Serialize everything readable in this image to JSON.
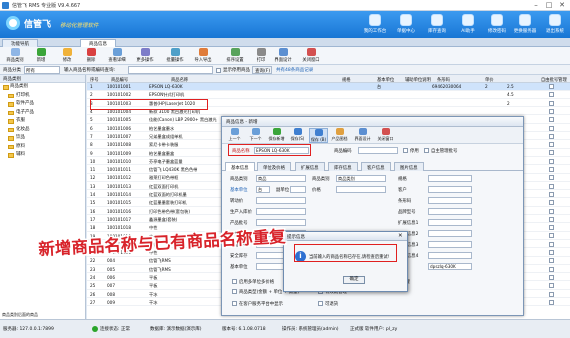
{
  "window": {
    "title": "信管飞 RMS 专业版 V9.4.667"
  },
  "brand": {
    "name": "信管飞",
    "slogan": "移动化管理软件"
  },
  "top_toolbar": [
    {
      "label": "我的工作台",
      "icon": "desktop-icon"
    },
    {
      "label": "单据中心",
      "icon": "document-icon"
    },
    {
      "label": "库存查询",
      "icon": "box-icon"
    },
    {
      "label": "AI助手",
      "icon": "ai-icon"
    },
    {
      "label": "修改密码",
      "icon": "lock-icon"
    },
    {
      "label": "更换服务器",
      "icon": "server-icon"
    },
    {
      "label": "退出系统",
      "icon": "exit-icon"
    }
  ],
  "tabs": [
    {
      "label": "功能导航"
    },
    {
      "label": "商品信息"
    }
  ],
  "toolbar": [
    {
      "label": "商品类别"
    },
    {
      "label": "新增"
    },
    {
      "label": "修改"
    },
    {
      "label": "删除"
    },
    {
      "label": "查看详细"
    },
    {
      "label": "更多操作"
    },
    {
      "label": "批量操作"
    },
    {
      "label": "导入导出"
    },
    {
      "label": "排序设置"
    },
    {
      "label": "打印"
    },
    {
      "label": "界面设计"
    },
    {
      "label": "关闭窗口"
    }
  ],
  "filter": {
    "category_label": "商品分类",
    "category_value": "所有",
    "search_label": "输入商品名称或编码查询:",
    "checkbox_label": "显示停用商品",
    "query_button": "查询(F)",
    "result_text": "共有48条商品记录"
  },
  "left_panel": {
    "header": "商品类别",
    "categories": [
      "打印机",
      "软件产品",
      "电子产品",
      "衣服",
      "化妆品",
      "饮品",
      "原料",
      "辅料"
    ],
    "show_sub": "商品类别后面的商品",
    "footer": "服务器: 127.0.0.1:7899"
  },
  "grid": {
    "columns": [
      "序号",
      "商品编号",
      "商品名称",
      "规格",
      "基本单位",
      "辅助单位说明",
      "条形码",
      "",
      "单价",
      "",
      "",
      "自由批号管理"
    ],
    "rows": [
      {
        "no": "1",
        "code": "100101001",
        "name": "EPSON LQ-630K"
      },
      {
        "no": "2",
        "code": "100101002",
        "name": "EPSON针式打印机"
      },
      {
        "no": "3",
        "code": "100101003",
        "name": "惠普(HP)LaserJet 1020"
      },
      {
        "no": "4",
        "code": "100101004",
        "name": "新款 3100 黑白激光打印机"
      },
      {
        "no": "5",
        "code": "100101005",
        "name": "佳能(Canon) LBP 2900+ 黑白激光"
      },
      {
        "no": "6",
        "code": "100101006",
        "name": "柏艺墨盒墨水"
      },
      {
        "no": "7",
        "code": "100101007",
        "name": "兄弟墨盒成组单机"
      },
      {
        "no": "8",
        "code": "100101008",
        "name": "索尼卡带卡装服"
      },
      {
        "no": "9",
        "code": "100101009",
        "name": "柏艺墨盒墨盒"
      },
      {
        "no": "10",
        "code": "100101010",
        "name": "芬亭电子墨盒蓝量"
      },
      {
        "no": "11",
        "code": "100101011",
        "name": "信管飞 LQ430K 黑色色带"
      },
      {
        "no": "12",
        "code": "100101012",
        "name": "雅莱打印色带框"
      },
      {
        "no": "13",
        "code": "100101013",
        "name": "红蓝双面打印机"
      },
      {
        "no": "14",
        "code": "100101014",
        "name": "红蓝双面的打印机墨"
      },
      {
        "no": "15",
        "code": "100101015",
        "name": "红蓝墨墨套装打印机"
      },
      {
        "no": "16",
        "code": "100101016",
        "name": "打印色带色带(套包装)"
      },
      {
        "no": "17",
        "code": "100101017",
        "name": "鑫源墨盒(套装)"
      },
      {
        "no": "18",
        "code": "100101018",
        "name": "中性"
      },
      {
        "no": "19",
        "code": "100101019",
        "name": "中性"
      },
      {
        "no": "20",
        "code": "100101020",
        "name": "中性"
      },
      {
        "no": "21",
        "code": "100101021",
        "name": "中性"
      },
      {
        "no": "22",
        "code": "004",
        "name": "信管飞RMS"
      },
      {
        "no": "23",
        "code": "005",
        "name": "信管飞RMS"
      },
      {
        "no": "24",
        "code": "006",
        "name": "平板"
      },
      {
        "no": "25",
        "code": "007",
        "name": "平板"
      },
      {
        "no": "26",
        "code": "008",
        "name": "干冰"
      },
      {
        "no": "27",
        "code": "009",
        "name": "干冰"
      }
    ],
    "right_values": [
      {
        "price": "2",
        "v": "2.5"
      },
      {
        "price": "",
        "v": "4.5"
      },
      {
        "price": "",
        "v": "2"
      }
    ],
    "first_barcode": "69462030064",
    "first_unit": "台"
  },
  "dialog": {
    "title": "商品信息 - 新增",
    "toolbar": [
      "上一个",
      "下一个",
      "保存新增",
      "保存(S)",
      "保存 (B)",
      "产品图档",
      "界面设计",
      "关闭窗口"
    ],
    "name_label": "商品名称",
    "name_value": "EPSON LQ-630K",
    "code_label": "商品编码",
    "code_value": "",
    "stop_label": "停用",
    "batch_label": "自主管理批号",
    "tabs": [
      "基本信息",
      "单位及价格",
      "扩展信息",
      "库存信息",
      "客户信息",
      "图片信息"
    ],
    "fields": {
      "category_label": "商品类别",
      "category_value": "商品",
      "category2_label": "商品类别",
      "category2_value": "商品类别",
      "spec_label": "规格",
      "unit_label": "基本单位",
      "unit_value": "台",
      "aux_label": "副单位",
      "unit_type_label": "价格",
      "customer_label": "客户",
      "price_label": "转动价",
      "barcode_label": "条形码",
      "origin_label": "生产入库价",
      "brand_label": "品牌型号",
      "product_no_label": "产品批号",
      "weight_label": "重量",
      "ext1_label": "扩展信息1",
      "ext2_label": "扩展信息2",
      "ext3_label": "扩展信息3",
      "ext4_label": "扩展信息4",
      "reserve_label": "预警库存",
      "safe_label": "安全库存",
      "price_field_label": "批发价",
      "note_label": "备注",
      "base_label": "基本单位",
      "stock_label": "库存数量",
      "sn_label": "条码",
      "serial_value": "dpszlq-630K",
      "radio1": "启用多单位多价格",
      "radio2": "启用批号管理",
      "radio3": "启用序列号管理",
      "check1": "商品类型(金额 + 单位 + 数量)",
      "check2": "有效期管理",
      "check3": "在客户服务平台中显示",
      "check4": "可退货"
    }
  },
  "message_box": {
    "title": "提示信息",
    "text": "当前输入的商品名称已存在,请检查后重试!",
    "ok": "确定"
  },
  "overlay_caption": "新增商品名称与已有商品名称重复",
  "status": {
    "server": "服务器: 127.0.0.1:7899",
    "connection": "连接状态: 正常",
    "db": "数据库: 演示数据(演示库)",
    "version": "版本号: 6.1.08.0718",
    "operator": "操作员: 系统管理员(admin)",
    "edition": "正式版 软件用户: pl_zy"
  }
}
